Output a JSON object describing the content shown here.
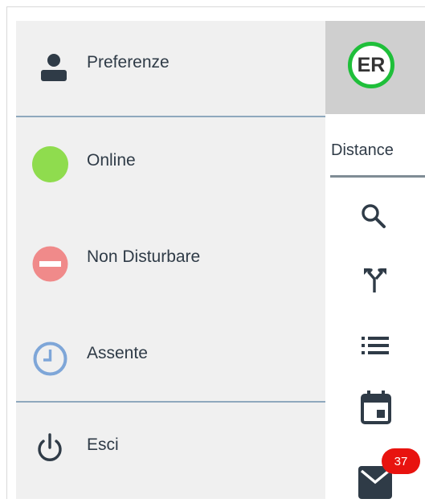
{
  "menu": {
    "preferences_label": "Preferenze",
    "status_items": [
      {
        "label": "Online",
        "color": "#8fdc4e"
      },
      {
        "label": "Non Disturbare",
        "color": "#f08a8a"
      },
      {
        "label": "Assente",
        "color": "#7ea6d8"
      }
    ],
    "logout_label": "Esci"
  },
  "header": {
    "avatar_initials": "ER",
    "avatar_ring_color": "#1fbf3a"
  },
  "toolbar": {
    "tab_label": "Distance",
    "icons": [
      "search-icon",
      "merge-icon",
      "list-icon",
      "calendar-icon",
      "mail-icon"
    ],
    "mail_badge_count": "37",
    "badge_color": "#e8130f"
  }
}
